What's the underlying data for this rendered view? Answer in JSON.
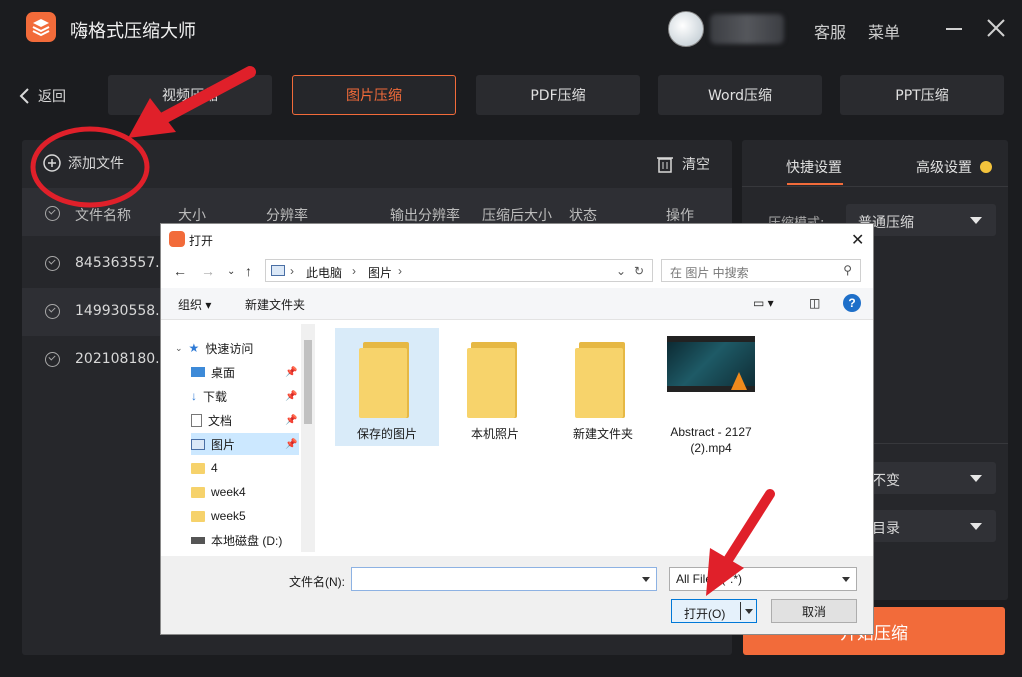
{
  "app": {
    "title": "嗨格式压缩大师",
    "service": "客服",
    "menu": "菜单",
    "back": "返回"
  },
  "tabs": [
    {
      "label": "视频压缩"
    },
    {
      "label": "图片压缩"
    },
    {
      "label": "PDF压缩"
    },
    {
      "label": "Word压缩"
    },
    {
      "label": "PPT压缩"
    }
  ],
  "left": {
    "add_file": "添加文件",
    "clear": "清空",
    "columns": [
      "文件名称",
      "大小",
      "分辨率",
      "输出分辨率",
      "压缩后大小",
      "状态",
      "操作"
    ],
    "rows": [
      {
        "name": "845363557..."
      },
      {
        "name": "149930558..."
      },
      {
        "name": "202108180..."
      }
    ]
  },
  "right": {
    "quick_settings": "快捷设置",
    "advanced_settings": "高级设置",
    "compress_mode_label": "压缩模式:",
    "compress_mode_value": "普通压缩",
    "format_value": "式不变",
    "output_dir_value": "件目录",
    "start_button": "开始压缩"
  },
  "dialog": {
    "title": "打开",
    "breadcrumb": [
      "此电脑",
      "图片"
    ],
    "search_placeholder": "在 图片 中搜索",
    "organize": "组织",
    "new_folder": "新建文件夹",
    "nav_items": [
      {
        "label": "快速访问"
      },
      {
        "label": "桌面"
      },
      {
        "label": "下载"
      },
      {
        "label": "文档"
      },
      {
        "label": "图片"
      },
      {
        "label": "4"
      },
      {
        "label": "week4"
      },
      {
        "label": "week5"
      },
      {
        "label": "本地磁盘 (D:)"
      }
    ],
    "files": [
      {
        "label": "保存的图片"
      },
      {
        "label": "本机照片"
      },
      {
        "label": "新建文件夹"
      },
      {
        "label": "Abstract - 2127 (2).mp4"
      }
    ],
    "filename_label": "文件名(N):",
    "filename_value": "",
    "filter_value": "All Files (*.*)",
    "open_button": "打开(O)",
    "cancel_button": "取消"
  },
  "colors": {
    "accent": "#f26b3a",
    "arrow": "#e0202a"
  }
}
